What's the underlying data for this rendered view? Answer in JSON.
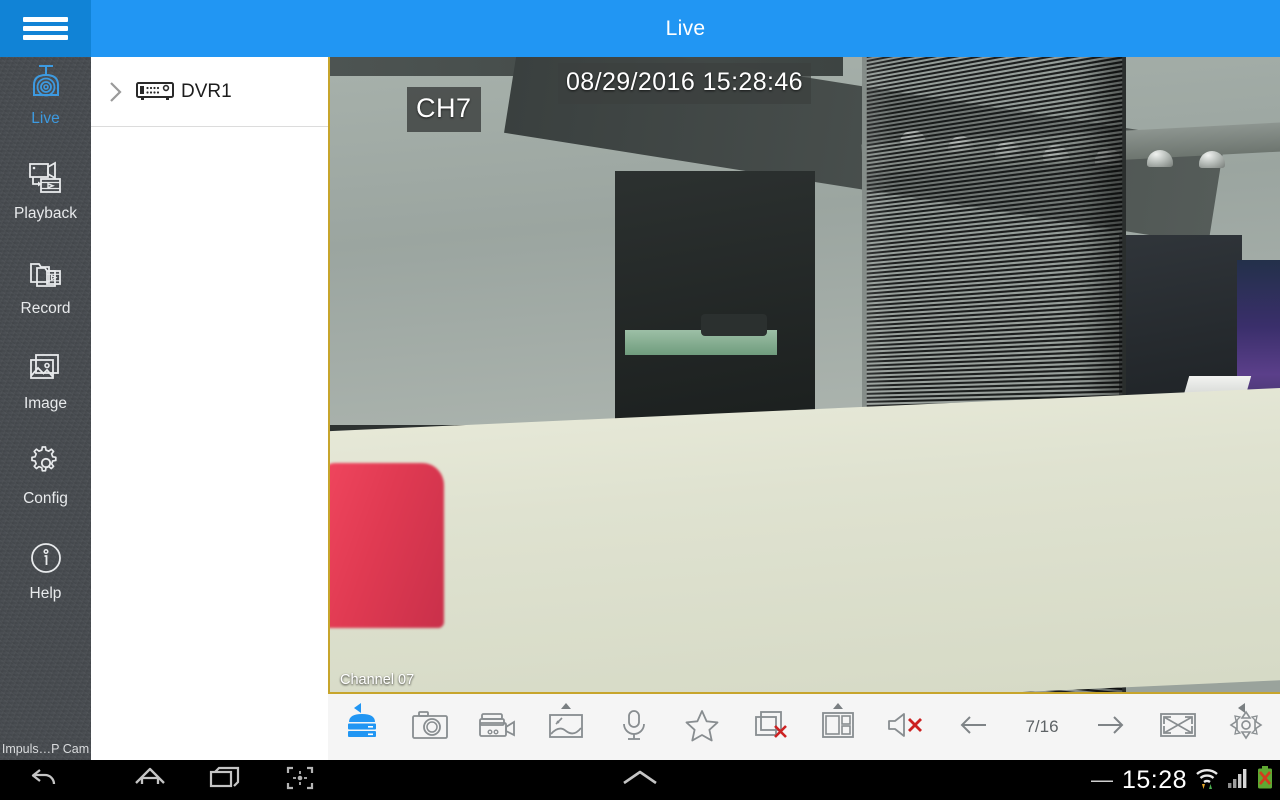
{
  "header": {
    "title": "Live",
    "menu_icon": "hamburger-icon"
  },
  "sidebar": {
    "items": [
      {
        "label": "Live",
        "icon": "dome-camera-icon",
        "active": true
      },
      {
        "label": "Playback",
        "icon": "playback-film-icon",
        "active": false
      },
      {
        "label": "Record",
        "icon": "record-folder-film-icon",
        "active": false
      },
      {
        "label": "Image",
        "icon": "image-stack-icon",
        "active": false
      },
      {
        "label": "Config",
        "icon": "gear-icon",
        "active": false
      },
      {
        "label": "Help",
        "icon": "info-circle-icon",
        "active": false
      }
    ],
    "footer_text": "Impuls…P Cam"
  },
  "device_list": {
    "devices": [
      {
        "name": "DVR1",
        "expand_icon": "chevron-right-icon",
        "device_icon": "dvr-box-icon"
      }
    ]
  },
  "video": {
    "osd_channel": "CH7",
    "osd_timestamp": "08/29/2016 15:28:46",
    "channel_label": "Channel 07",
    "border_color": "#c7a52c",
    "selected": true
  },
  "toolbar": {
    "items": [
      {
        "name": "stream-quality-button",
        "icon": "server-stack-icon",
        "caret": "left-blue",
        "active": true
      },
      {
        "name": "snapshot-button",
        "icon": "camera-icon",
        "caret": "none",
        "active": false
      },
      {
        "name": "record-button",
        "icon": "video-camera-icon",
        "caret": "none",
        "active": false
      },
      {
        "name": "image-adjust-button",
        "icon": "picture-edit-icon",
        "caret": "up",
        "active": false
      },
      {
        "name": "talk-button",
        "icon": "microphone-icon",
        "caret": "none",
        "active": false
      },
      {
        "name": "favorite-button",
        "icon": "star-icon",
        "caret": "none",
        "active": false
      },
      {
        "name": "close-all-button",
        "icon": "close-windows-icon",
        "caret": "none",
        "active": false
      },
      {
        "name": "layout-button",
        "icon": "split-layout-icon",
        "caret": "up",
        "active": false
      },
      {
        "name": "mute-button",
        "icon": "speaker-muted-icon",
        "caret": "none",
        "active": false
      },
      {
        "name": "prev-page-button",
        "icon": "arrow-left-icon",
        "caret": "none",
        "active": false
      },
      {
        "name": "page-indicator",
        "icon": "text",
        "caret": "none",
        "active": false,
        "text": "7/16"
      },
      {
        "name": "next-page-button",
        "icon": "arrow-right-icon",
        "caret": "none",
        "active": false
      },
      {
        "name": "fullscreen-button",
        "icon": "fullscreen-icon",
        "caret": "none",
        "active": false
      },
      {
        "name": "ptz-button",
        "icon": "ptz-dpad-icon",
        "caret": "left-gray",
        "active": false
      }
    ],
    "page_indicator": "7/16"
  },
  "navbar": {
    "buttons": [
      {
        "name": "back-button",
        "icon": "back-arrow-icon"
      },
      {
        "name": "home-button",
        "icon": "home-icon"
      },
      {
        "name": "recents-button",
        "icon": "recents-icon"
      },
      {
        "name": "screenshot-button",
        "icon": "screenshot-icon"
      },
      {
        "name": "expand-button",
        "icon": "chevron-up-icon"
      }
    ],
    "clock": "15:28",
    "dash": "—",
    "status_icons": [
      "wifi-icon",
      "signal-icon",
      "battery-error-icon"
    ]
  }
}
